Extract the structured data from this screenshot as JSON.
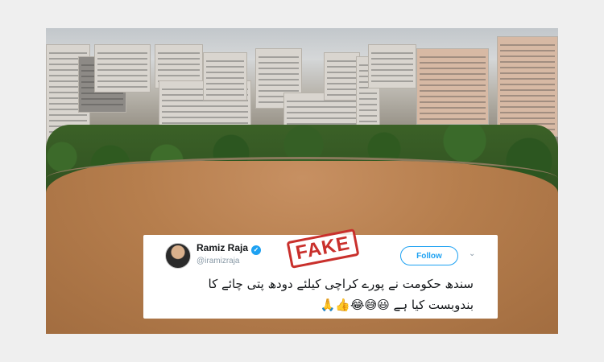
{
  "tweet": {
    "name": "Ramiz Raja",
    "handle": "@iramizraja",
    "follow_label": "Follow",
    "text_line1": "سندھ حکومت نے پورے کراچی کیلئے دودھ پتی چائے کا",
    "text_line2": "بندوبست کیا ہے 😃😅😂👍🙏",
    "stamp": "FAKE"
  },
  "icons": {
    "verified": "verified-badge-icon",
    "chevron": "chevron-down-icon"
  },
  "colors": {
    "twitter_blue": "#1da1f2",
    "stamp_red": "#c9302c",
    "background": "#efefef"
  }
}
